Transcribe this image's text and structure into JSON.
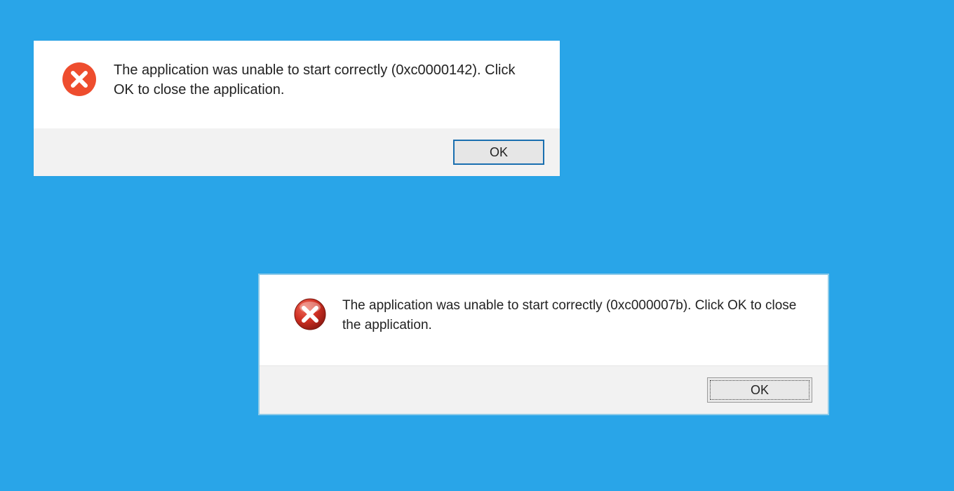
{
  "dialogs": [
    {
      "icon": "error-x",
      "message": "The application was unable to start correctly (0xc0000142). Click OK to close the application.",
      "ok_label": "OK"
    },
    {
      "icon": "error-x",
      "message": "The application was unable to start correctly (0xc000007b). Click OK to close the application.",
      "ok_label": "OK"
    }
  ],
  "colors": {
    "background": "#29a5e8",
    "dialog1_ok_border": "#1a6fb0",
    "dialog2_border": "#8fcbe8",
    "error_icon_flat": "#ee4d2e",
    "error_icon_glossy": "#c0392b"
  }
}
